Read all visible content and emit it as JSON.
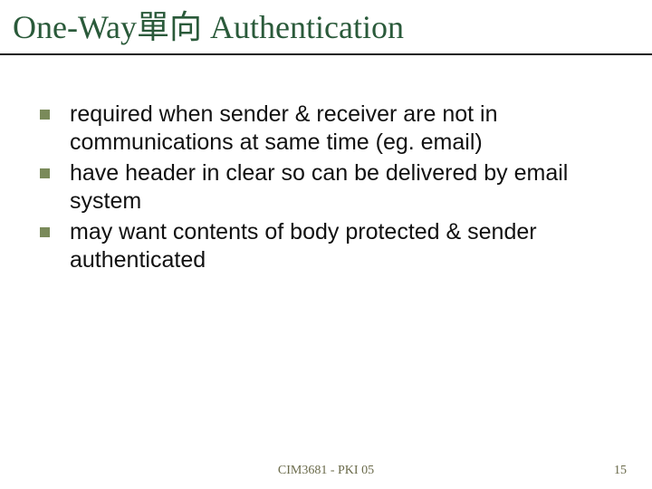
{
  "title": "One-Way單向 Authentication",
  "bullets": [
    "required when sender & receiver are not in communications at same time (eg. email)",
    "have header in clear so can be delivered by email system",
    "may want contents of body protected & sender authenticated"
  ],
  "footer": "CIM3681 - PKI 05",
  "page": "15"
}
